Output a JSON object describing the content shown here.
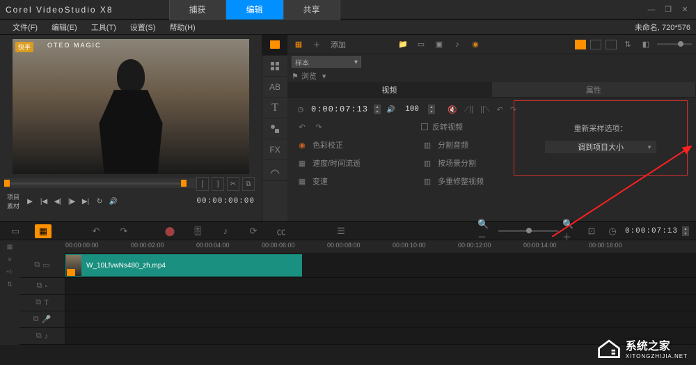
{
  "app": {
    "brand": "Corel",
    "name": "VideoStudio X8"
  },
  "topTabs": {
    "capture": "捕获",
    "edit": "编辑",
    "share": "共享"
  },
  "menu": {
    "file": "文件(F)",
    "edit": "编辑(E)",
    "tools": "工具(T)",
    "settings": "设置(S)",
    "help": "帮助(H)"
  },
  "docStatus": "未命名, 720*576",
  "preview": {
    "stamp": "快手",
    "stamp2": "OTEO  MAGIC",
    "labelProject": "项目",
    "labelClip": "素材",
    "timecode": "00:00:00:00"
  },
  "library": {
    "add": "添加",
    "browse": "浏览",
    "combo": "样本"
  },
  "optTabs": {
    "video": "视频",
    "attr": "属性"
  },
  "video": {
    "duration": "0:00:07:13",
    "volume": "100",
    "reverse": "反转视频",
    "color": "色彩校正",
    "split": "分割音频",
    "speed": "速度/时间流逝",
    "scene": "按场景分割",
    "varSpeed": "变速",
    "multitrim": "多重修整视频"
  },
  "resample": {
    "label": "重新采样选项：",
    "value": "调到项目大小"
  },
  "timeline": {
    "marks": [
      "00:00:00:00",
      "00:00:02:00",
      "00:00:04:00",
      "00:00:06:00",
      "00:00:08:00",
      "00:00:10:00",
      "00:00:12:00",
      "00:00:14:00",
      "00:00:16:00"
    ],
    "zoomTime": "0:00:07:13",
    "clipName": "W_10LfvwNs480_zh.mp4"
  },
  "watermark": {
    "title": "系统之家",
    "sub": "XITONGZHIJIA.NET"
  }
}
